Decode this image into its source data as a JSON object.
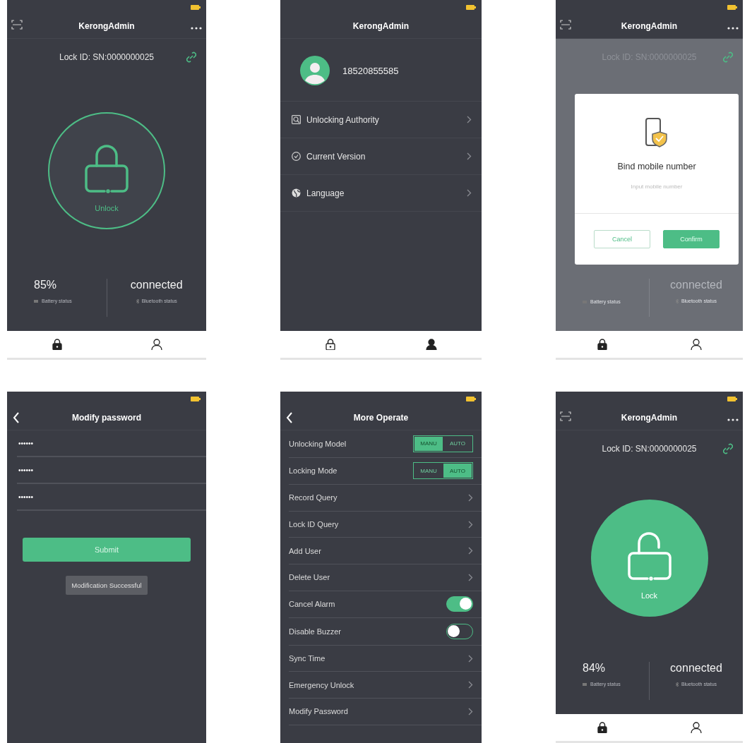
{
  "screens": [
    {
      "kind": "lock",
      "title": "KerongAdmin",
      "lock_id": "Lock ID: SN:0000000025",
      "dimmed": false,
      "unlocked": false,
      "action": "Unlock",
      "battery": "85%",
      "battery_label": "Battery status",
      "connection": "connected",
      "connection_label": "Bluetooth status",
      "tabs": [
        {
          "selected": true
        },
        {
          "selected": false
        }
      ]
    },
    {
      "kind": "profile",
      "title": "KerongAdmin",
      "phone": "18520855585",
      "menu": [
        {
          "label": "Unlocking Authority"
        },
        {
          "label": "Current Version"
        },
        {
          "label": "Language"
        }
      ],
      "tabs": [
        {
          "selected": false
        },
        {
          "selected": true
        }
      ]
    },
    {
      "kind": "lock",
      "title": "KerongAdmin",
      "lock_id": "Lock ID: SN:0000000025",
      "dimmed": true,
      "battery_label": "Battery status",
      "connection": "connected",
      "connection_label": "Bluetooth status",
      "dialog": {
        "title": "Bind mobile number",
        "placeholder": "Input mobile number",
        "cancel": "Cancel",
        "confirm": "Confirm"
      },
      "tabs": [
        {
          "selected": true
        },
        {
          "selected": false
        }
      ]
    },
    {
      "kind": "password",
      "title": "Modify password",
      "fields": [
        {
          "value": "••••••"
        },
        {
          "value": "••••••"
        },
        {
          "value": "••••••"
        }
      ],
      "submit": "Submit",
      "toast": "Modification Successful"
    },
    {
      "kind": "settings",
      "title": "More Operate",
      "rows": [
        {
          "kind": "segmented",
          "label": "Unlocking Model",
          "options": [
            {
              "label": "MANU",
              "selected": true
            },
            {
              "label": "AUTO",
              "selected": false
            }
          ]
        },
        {
          "kind": "segmented",
          "label": "Locking Mode",
          "options": [
            {
              "label": "MANU",
              "selected": false
            },
            {
              "label": "AUTO",
              "selected": true
            }
          ]
        },
        {
          "kind": "link",
          "label": "Record Query"
        },
        {
          "kind": "link",
          "label": "Lock ID Query"
        },
        {
          "kind": "link",
          "label": "Add User"
        },
        {
          "kind": "link",
          "label": "Delete User"
        },
        {
          "kind": "toggle",
          "label": "Cancel Alarm",
          "on": true
        },
        {
          "kind": "toggle",
          "label": "Disable Buzzer",
          "on": false
        },
        {
          "kind": "link",
          "label": "Sync Time"
        },
        {
          "kind": "link",
          "label": "Emergency Unlock"
        },
        {
          "kind": "link",
          "label": "Modify Password"
        }
      ]
    },
    {
      "kind": "lock",
      "title": "KerongAdmin",
      "lock_id": "Lock ID: SN:0000000025",
      "dimmed": false,
      "unlocked": true,
      "action": "Lock",
      "battery": "84%",
      "battery_label": "Battery status",
      "connection": "connected",
      "connection_label": "Bluetooth status",
      "tabs": [
        {
          "selected": true
        },
        {
          "selected": false
        }
      ]
    }
  ]
}
